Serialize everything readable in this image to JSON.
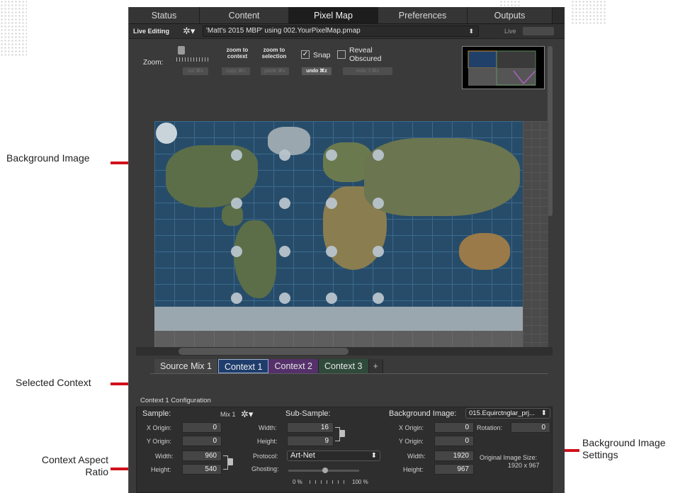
{
  "tabs": [
    "Status",
    "Content",
    "Pixel Map",
    "Preferences",
    "Outputs"
  ],
  "active_tab": "Pixel Map",
  "editbar": {
    "live_editing": "Live Editing",
    "file": "'Matt's 2015 MBP' using 002.YourPixelMap.pmap",
    "live": "Live"
  },
  "toolbar": {
    "zoom_label": "Zoom:",
    "zoom_to_context": "zoom to context",
    "zoom_to_selection": "zoom to selection",
    "snap": "Snap",
    "reveal_obscured": "Reveal Obscured",
    "cut": "cut ⌘x",
    "copy": "copy ⌘c",
    "paste": "paste ⌘v",
    "undo": "undo ⌘z",
    "redo": "redo ⇧⌘z"
  },
  "context_tabs": [
    "Source Mix 1",
    "Context 1",
    "Context 2",
    "Context 3",
    "+"
  ],
  "selected_context": "Context 1",
  "config": {
    "title": "Context 1 Configuration",
    "sample_label": "Sample:",
    "sample_value": "Mix 1",
    "x_origin_label": "X Origin:",
    "x_origin": "0",
    "y_origin_label": "Y Origin:",
    "y_origin": "0",
    "width_label": "Width:",
    "width": "960",
    "height_label": "Height:",
    "height": "540",
    "subsample_label": "Sub-Sample:",
    "sub_width_label": "Width:",
    "sub_width": "16",
    "sub_height_label": "Height:",
    "sub_height": "9",
    "protocol_label": "Protocol:",
    "protocol": "Art-Net",
    "ghosting_label": "Ghosting:",
    "ghosting_min": "0 %",
    "ghosting_max": "100 %",
    "bg_image_label": "Background Image:",
    "bg_image_value": "015.Equirctnglar_prj...",
    "bg_x_origin": "0",
    "bg_y_origin": "0",
    "bg_width": "1920",
    "bg_height": "967",
    "rotation_label": "Rotation:",
    "rotation": "0",
    "original_size_label": "Original Image Size:",
    "original_size": "1920 x 967"
  },
  "annotations": {
    "background_image": "Background Image",
    "selected_context": "Selected Context",
    "context_aspect_ratio_1": "Context Aspect",
    "context_aspect_ratio_2": "Ratio",
    "bg_settings_1": "Background Image",
    "bg_settings_2": "Settings"
  },
  "colors": {
    "annotation_line": "#d0111b",
    "context_1": "#1e3d6c",
    "context_2": "#55306b",
    "context_3": "#2f4a3a"
  }
}
